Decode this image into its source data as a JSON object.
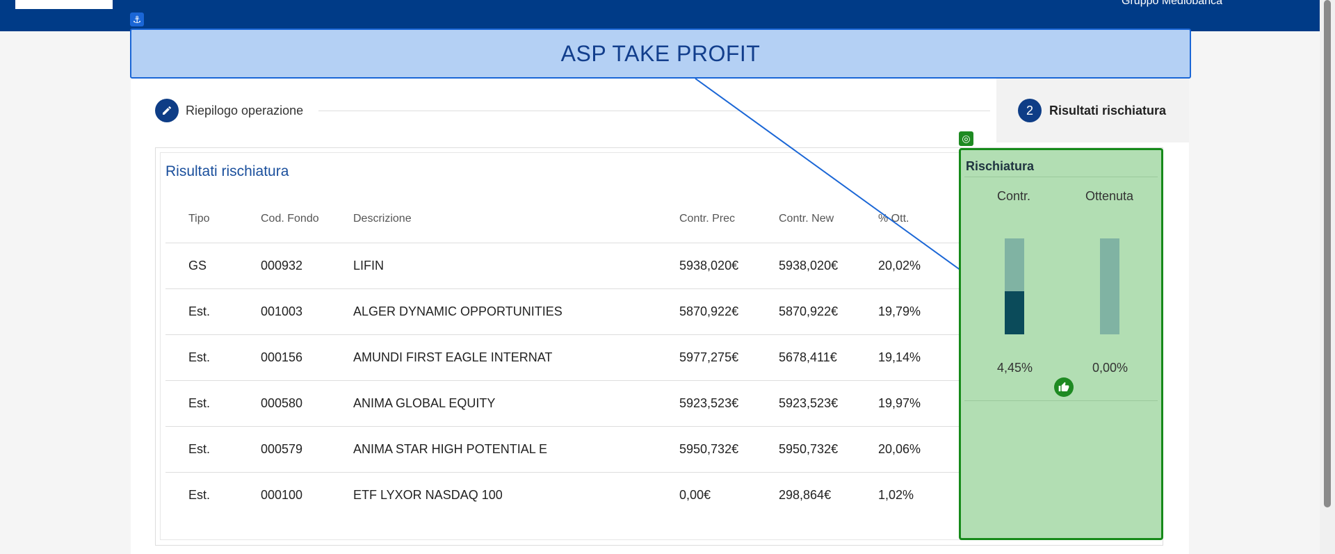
{
  "header": {
    "brand_text": "Gruppo Mediobanca"
  },
  "annotation": {
    "title": "ASP TAKE PROFIT",
    "anchor_icon": "⚓",
    "target_icon": "◎"
  },
  "stepper": {
    "step1_label": "Riepilogo operazione",
    "step2_number": "2",
    "step2_label": "Risultati rischiatura"
  },
  "results": {
    "title": "Risultati rischiatura",
    "columns": [
      "Tipo",
      "Cod. Fondo",
      "Descrizione",
      "Contr. Prec",
      "Contr. New",
      "% Ott."
    ],
    "rows": [
      {
        "tipo": "GS",
        "cod": "000932",
        "desc": "LIFIN",
        "prec": "5938,020€",
        "new": "5938,020€",
        "ott": "20,02%"
      },
      {
        "tipo": "Est.",
        "cod": "001003",
        "desc": "ALGER DYNAMIC OPPORTUNITIES",
        "prec": "5870,922€",
        "new": "5870,922€",
        "ott": "19,79%"
      },
      {
        "tipo": "Est.",
        "cod": "000156",
        "desc": "AMUNDI FIRST EAGLE INTERNAT",
        "prec": "5977,275€",
        "new": "5678,411€",
        "ott": "19,14%"
      },
      {
        "tipo": "Est.",
        "cod": "000580",
        "desc": "ANIMA GLOBAL EQUITY",
        "prec": "5923,523€",
        "new": "5923,523€",
        "ott": "19,97%"
      },
      {
        "tipo": "Est.",
        "cod": "000579",
        "desc": "ANIMA STAR HIGH POTENTIAL E",
        "prec": "5950,732€",
        "new": "5950,732€",
        "ott": "20,06%"
      },
      {
        "tipo": "Est.",
        "cod": "000100",
        "desc": "ETF LYXOR NASDAQ 100",
        "prec": "0,00€",
        "new": "298,864€",
        "ott": "1,02%"
      }
    ]
  },
  "rischiatura": {
    "title": "Rischiatura",
    "contr_label": "Contr.",
    "ottenuta_label": "Ottenuta",
    "contr_value": "4,45%",
    "ottenuta_value": "0,00%",
    "contr_fill_fraction": 0.45,
    "ottenuta_fill_fraction": 0.0,
    "status_icon": "thumbs-up"
  },
  "colors": {
    "header_bg": "#003b87",
    "accent": "#1a4f9c",
    "annotation_blue": "#1a66d6",
    "annotation_green": "#168a1a"
  }
}
